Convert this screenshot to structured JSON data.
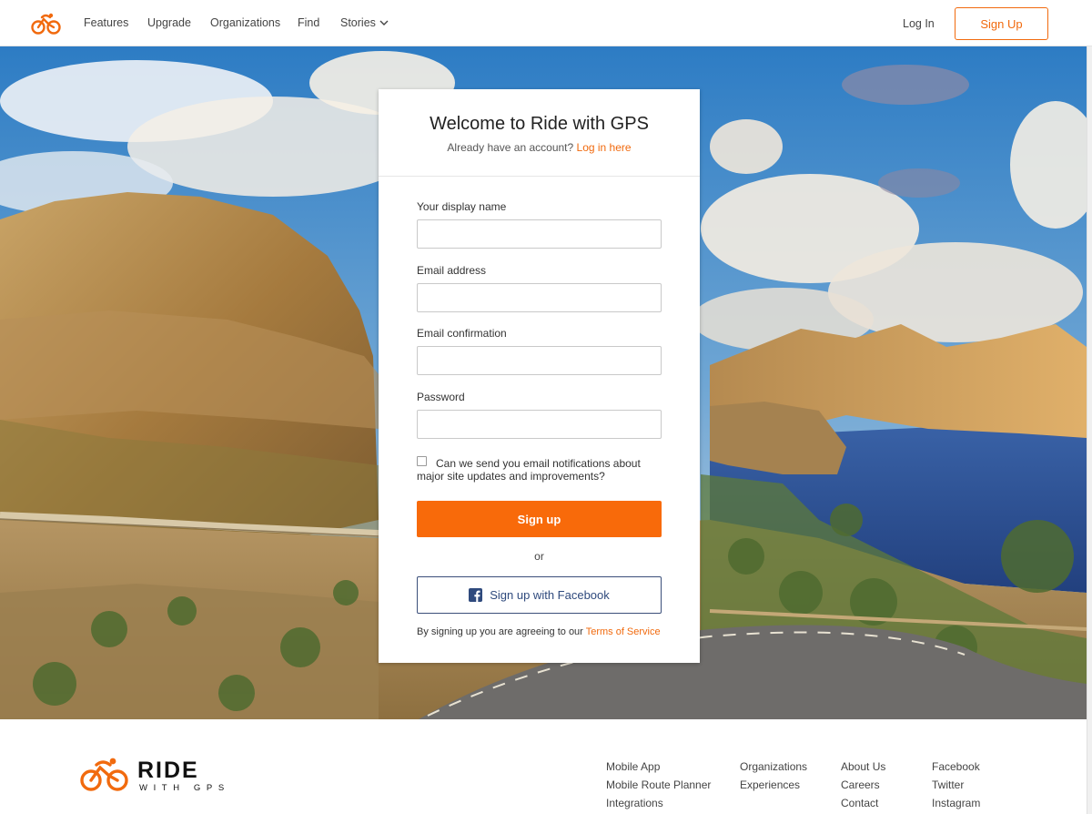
{
  "nav": {
    "links": [
      "Features",
      "Upgrade",
      "Organizations",
      "Find",
      "Stories"
    ],
    "login": "Log In",
    "signup": "Sign Up"
  },
  "card": {
    "title": "Welcome to Ride with GPS",
    "subtitle_prefix": "Already have an account?",
    "login_link": "Log in here",
    "fields": {
      "display_name": {
        "label": "Your display name",
        "value": ""
      },
      "email": {
        "label": "Email address",
        "value": ""
      },
      "email_confirm": {
        "label": "Email confirmation",
        "value": ""
      },
      "password": {
        "label": "Password",
        "value": ""
      }
    },
    "notify_checkbox": {
      "label": "Can we send you email notifications about major site updates and improvements?",
      "checked": false
    },
    "signup_button": "Sign up",
    "or": "or",
    "facebook_button": "Sign up with Facebook",
    "terms_prefix": "By signing up you are agreeing to our",
    "terms_link": "Terms of Service"
  },
  "footer": {
    "logo_word1": "RIDE",
    "logo_word2": "WITH GPS",
    "columns": [
      [
        "Mobile App",
        "Mobile Route Planner",
        "Integrations"
      ],
      [
        "Organizations",
        "Experiences"
      ],
      [
        "About Us",
        "Careers",
        "Contact"
      ],
      [
        "Facebook",
        "Twitter",
        "Instagram"
      ]
    ]
  },
  "colors": {
    "accent": "#f16a0e",
    "button_fill": "#f86a0a",
    "facebook": "#3b5998"
  }
}
